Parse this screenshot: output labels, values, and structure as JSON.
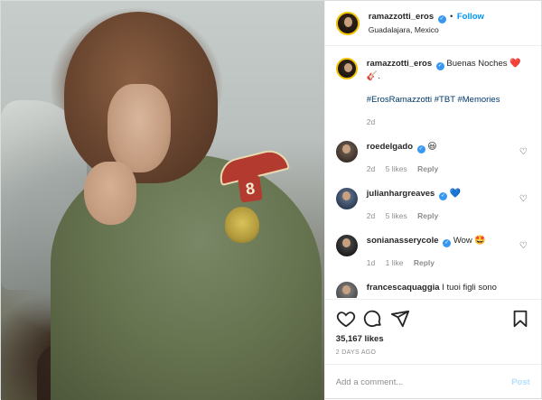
{
  "header": {
    "username": "ramazzotti_eros",
    "follow_label": "Follow",
    "separator": "•",
    "location": "Guadalajara, Mexico"
  },
  "caption": {
    "username": "ramazzotti_eros",
    "text": "Buenas Noches",
    "emoji1": "❤️",
    "emoji2": "🎸.",
    "hashtags": "#ErosRamazzotti #TBT #Memories",
    "time": "2d"
  },
  "comments": [
    {
      "username": "roedelgado",
      "text": "",
      "emoji": "😃",
      "time": "2d",
      "likes": "5 likes",
      "reply": "Reply"
    },
    {
      "username": "julianhargreaves",
      "text": "",
      "emoji": "💙",
      "time": "2d",
      "likes": "5 likes",
      "reply": "Reply"
    },
    {
      "username": "sonianasserycole",
      "text": "Wow",
      "emoji": "🤩",
      "time": "1d",
      "likes": "1 like",
      "reply": "Reply"
    },
    {
      "username": "francescaquaggia",
      "text": "I tuoi figli sono",
      "emoji": "",
      "time": "",
      "likes": "",
      "reply": ""
    }
  ],
  "actions": {
    "likes": "35,167 likes",
    "posted": "2 DAYS AGO"
  },
  "add_comment": {
    "placeholder": "Add a comment...",
    "post_label": "Post"
  },
  "colors": {
    "accent": "#0095f6",
    "verified": "#3897f0",
    "post_disabled": "#b2dffc",
    "heart": "#ed4956"
  },
  "icons": [
    "verified-badge-icon",
    "heart-icon",
    "comment-icon",
    "share-icon",
    "bookmark-icon"
  ]
}
